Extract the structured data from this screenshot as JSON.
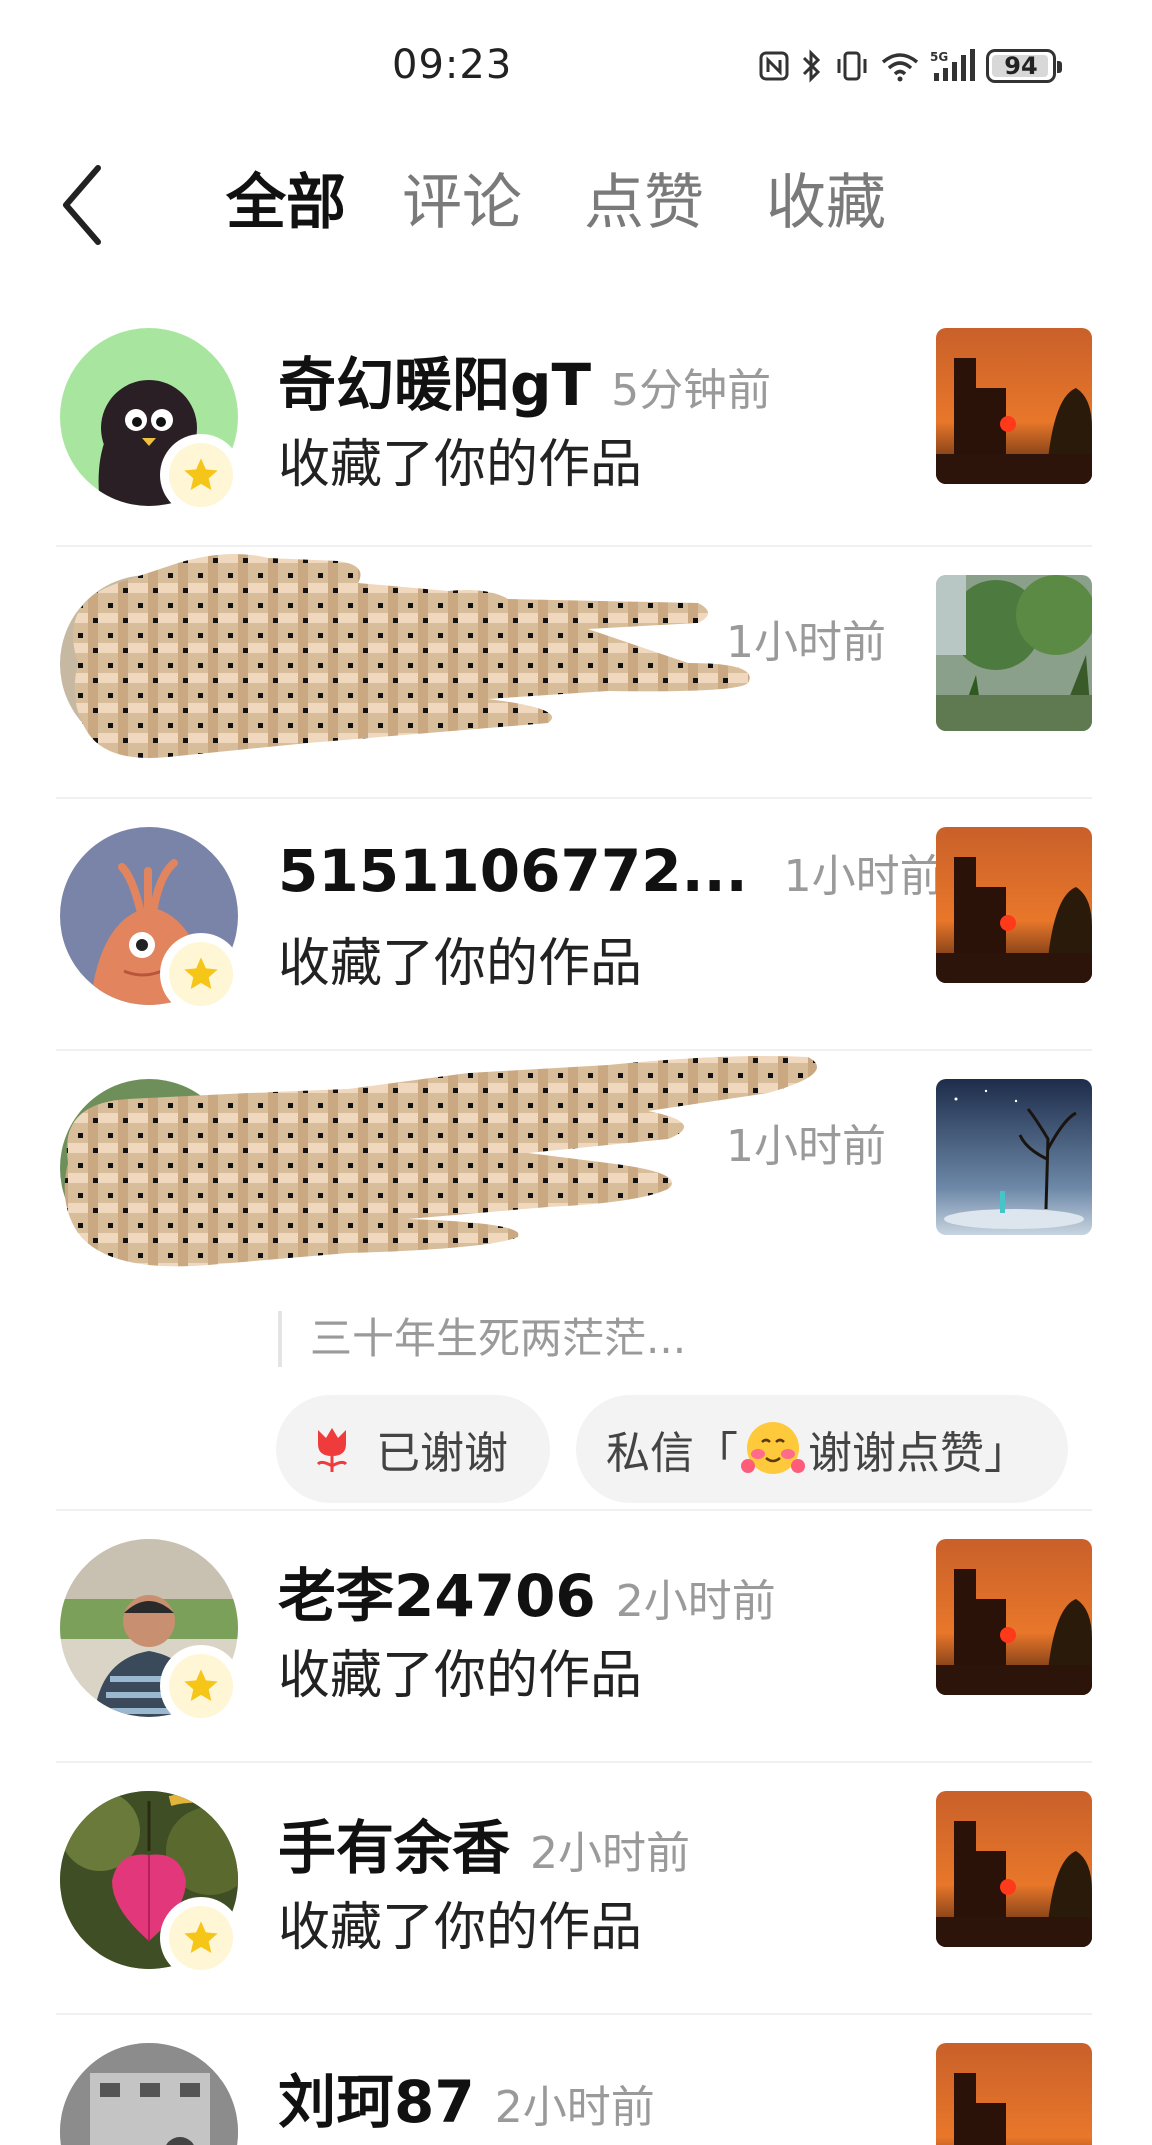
{
  "status_bar": {
    "time": "09:23",
    "battery": "94"
  },
  "tabs": [
    {
      "label": "全部"
    },
    {
      "label": "评论"
    },
    {
      "label": "点赞"
    },
    {
      "label": "收藏"
    }
  ],
  "items": [
    {
      "name": "奇幻暖阳gT",
      "time": "5分钟前",
      "action": "收藏了你的作品"
    },
    {
      "name": "",
      "time": "1小时前",
      "action": ""
    },
    {
      "name": "5151106772...",
      "time": "1小时前",
      "action": "收藏了你的作品"
    },
    {
      "name": "",
      "time": "1小时前",
      "action": "",
      "quote": "三十年生死两茫茫...",
      "thanked_label": "已谢谢",
      "dm_prefix": "私信「",
      "dm_text": "谢谢点赞」"
    },
    {
      "name": "老李24706",
      "time": "2小时前",
      "action": "收藏了你的作品"
    },
    {
      "name": "手有余香",
      "time": "2小时前",
      "action": "收藏了你的作品"
    },
    {
      "name": "刘珂87",
      "time": "2小时前",
      "action": ""
    }
  ],
  "colors": {
    "accent_star": "#f5c518",
    "muted_text": "#9a9a9a",
    "pill_bg": "#f3f3f3"
  }
}
